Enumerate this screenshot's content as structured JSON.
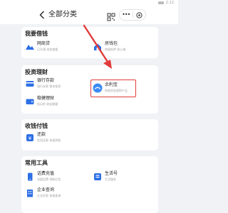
{
  "status_bar": {
    "time": "2:12"
  },
  "nav": {
    "title": "全部分类"
  },
  "sections": {
    "borrow": {
      "title": "我要借钱",
      "items": [
        {
          "name": "网商贷",
          "desc": "已开通 授信查看"
        },
        {
          "name": "房钱包",
          "desc": "房屋抵押 安心借"
        }
      ]
    },
    "invest": {
      "title": "投资理财",
      "items": [
        {
          "name": "银行存款",
          "desc": "银行存款 保本保息"
        },
        {
          "name": "余利宝",
          "desc": "网商资金理财产品"
        },
        {
          "name": "稳健理财",
          "desc": "低风险 收益稳健"
        }
      ]
    },
    "collect": {
      "title": "收钱付钱",
      "items": [
        {
          "name": "还款",
          "desc": "信用还款 快速到账"
        }
      ]
    },
    "tools": {
      "title": "常用工具",
      "items": [
        {
          "name": "话费充值",
          "desc": "充值话费 领取红包"
        },
        {
          "name": "生活号",
          "desc": "生活服务"
        },
        {
          "name": "企业查询",
          "desc": "企业信息 快速查询"
        }
      ]
    }
  },
  "colors": {
    "accent": "#2d6fe6",
    "highlight": "#e23a3a",
    "background": "#f1f2f5"
  }
}
